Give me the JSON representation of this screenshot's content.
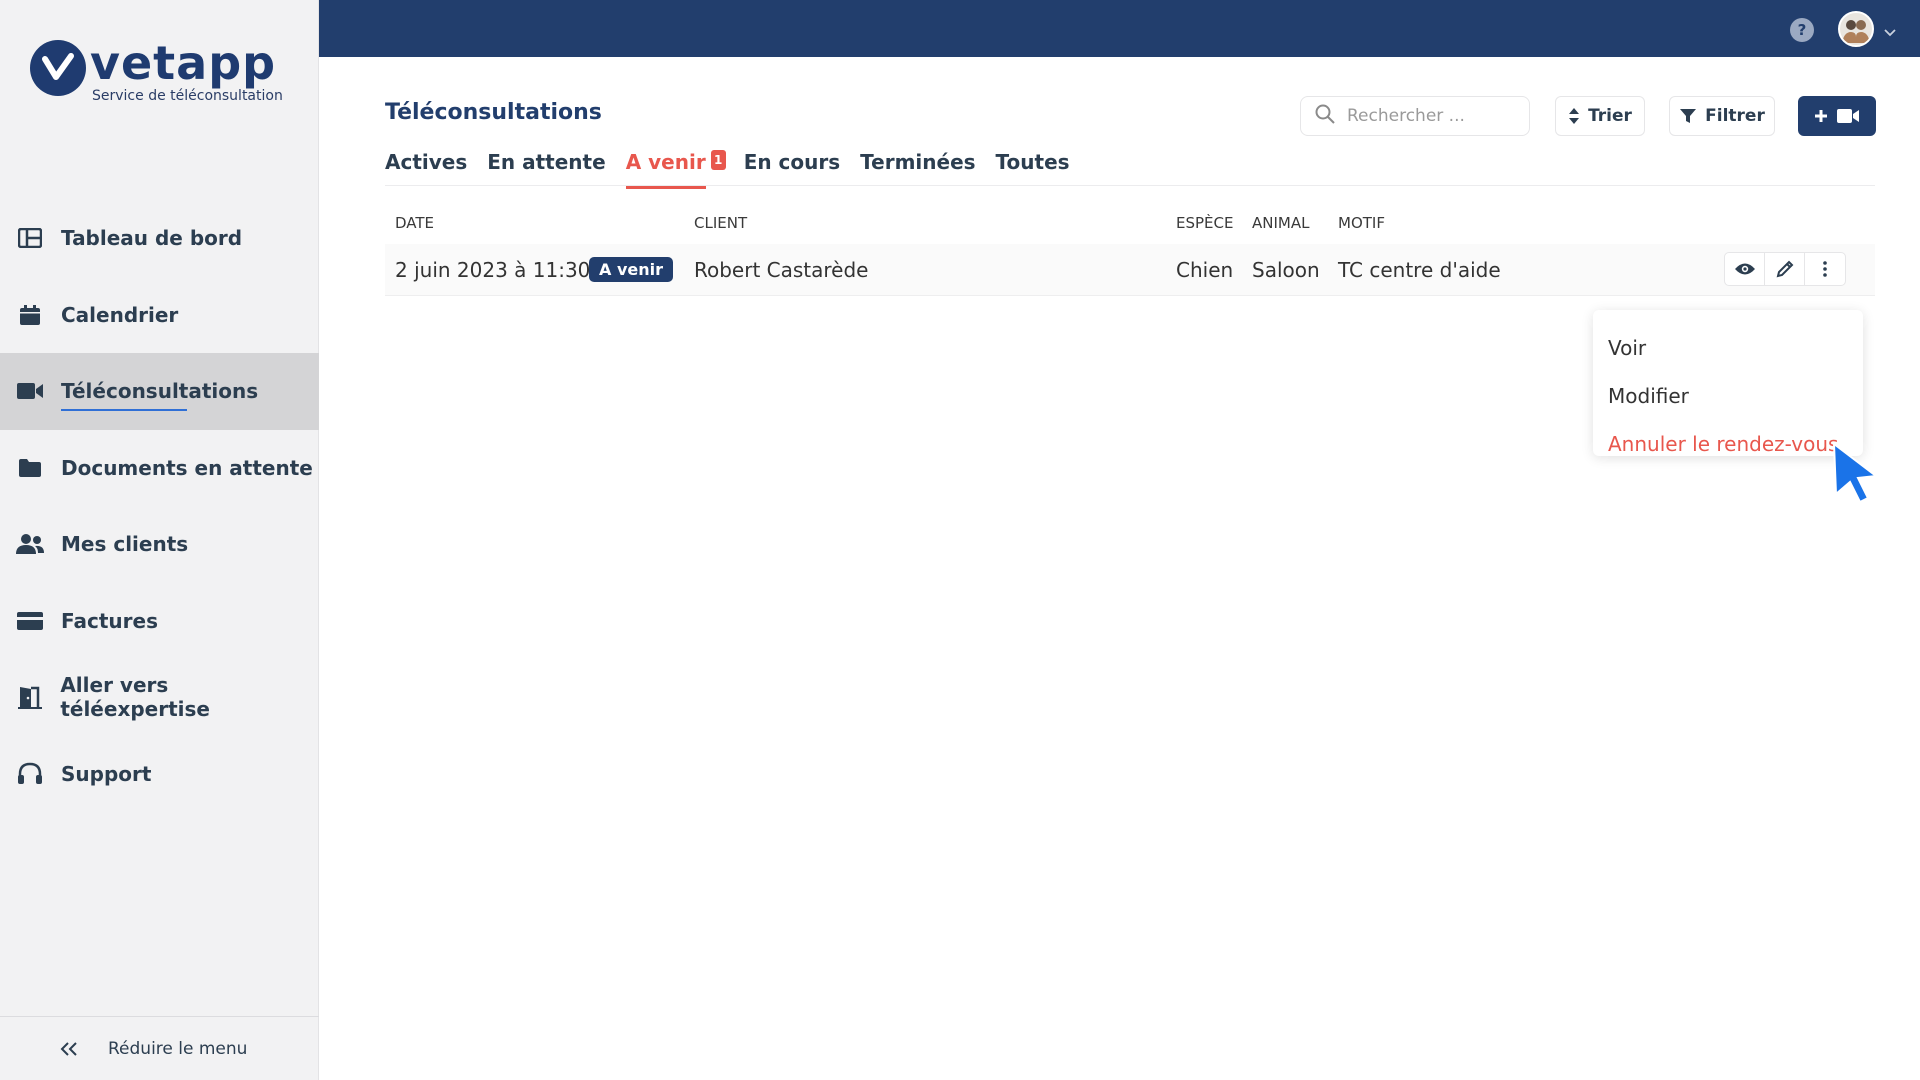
{
  "brand": {
    "name": "vetapp",
    "tagline": "Service de téléconsultation",
    "primary_color": "#223e6d",
    "accent_color": "#e8574d"
  },
  "sidebar": {
    "items": [
      {
        "label": "Tableau de bord",
        "icon": "dashboard-icon"
      },
      {
        "label": "Calendrier",
        "icon": "calendar-icon"
      },
      {
        "label": "Téléconsultations",
        "icon": "video-camera-icon",
        "active": true
      },
      {
        "label": "Documents en attente",
        "icon": "folder-icon"
      },
      {
        "label": "Mes clients",
        "icon": "users-icon"
      },
      {
        "label": "Factures",
        "icon": "credit-card-icon"
      },
      {
        "label": "Aller vers téléexpertise",
        "icon": "door-exit-icon"
      },
      {
        "label": "Support",
        "icon": "headset-icon"
      }
    ],
    "collapse_label": "Réduire le menu"
  },
  "topbar": {
    "help_icon": "question-icon",
    "help_text": "?",
    "avatar_icon": "user-avatar-icon"
  },
  "page": {
    "title": "Téléconsultations",
    "search_placeholder": "Rechercher ...",
    "sort_label": "Trier",
    "filter_label": "Filtrer"
  },
  "tabs": [
    {
      "label": "Actives"
    },
    {
      "label": "En attente"
    },
    {
      "label": "A venir",
      "active": true,
      "badge": "1"
    },
    {
      "label": "En cours"
    },
    {
      "label": "Terminées"
    },
    {
      "label": "Toutes"
    }
  ],
  "table": {
    "headers": {
      "date": "DATE",
      "client": "CLIENT",
      "espece": "ESPÈCE",
      "animal": "ANIMAL",
      "motif": "MOTIF"
    },
    "rows": [
      {
        "date": "2 juin 2023 à 11:30",
        "status": "A venir",
        "client": "Robert Castarède",
        "espece": "Chien",
        "animal": "Saloon",
        "motif": "TC centre d'aide"
      }
    ]
  },
  "context_menu": {
    "items": [
      {
        "label": "Voir"
      },
      {
        "label": "Modifier"
      },
      {
        "label": "Annuler le rendez-vous",
        "danger": true
      }
    ]
  }
}
